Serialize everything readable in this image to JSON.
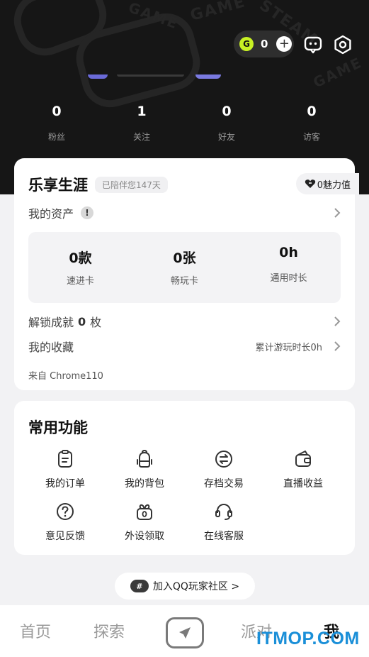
{
  "header": {
    "deco_words": [
      "GAME",
      "GAME",
      "STEAM",
      "GAME"
    ],
    "coins": {
      "icon": "G",
      "value": "0",
      "add_icon": "plus-icon"
    },
    "stats": [
      {
        "value": "0",
        "label": "粉丝"
      },
      {
        "value": "1",
        "label": "关注"
      },
      {
        "value": "0",
        "label": "好友"
      },
      {
        "value": "0",
        "label": "访客"
      }
    ]
  },
  "profile_card": {
    "title": "乐享生涯",
    "days_badge": "已陪伴您147天",
    "charm": "0魅力值",
    "assets_label": "我的资产",
    "assets_info_icon": "!",
    "assets": [
      {
        "value": "0款",
        "label": "速进卡"
      },
      {
        "value": "0张",
        "label": "畅玩卡"
      },
      {
        "value": "0h",
        "label": "通用时长"
      }
    ],
    "achievements_prefix": "解锁成就",
    "achievements_count": "0",
    "achievements_suffix": "枚",
    "favorites_label": "我的收藏",
    "play_time": "累计游玩时长0h",
    "source": "来自 Chrome110"
  },
  "functions_card": {
    "title": "常用功能",
    "items": [
      {
        "label": "我的订单",
        "icon": "clipboard-icon"
      },
      {
        "label": "我的背包",
        "icon": "backpack-icon"
      },
      {
        "label": "存档交易",
        "icon": "exchange-icon"
      },
      {
        "label": "直播收益",
        "icon": "wallet-icon"
      },
      {
        "label": "意见反馈",
        "icon": "question-icon"
      },
      {
        "label": "外设领取",
        "icon": "gift-icon"
      },
      {
        "label": "在线客服",
        "icon": "headset-icon"
      }
    ]
  },
  "community": {
    "icon_text": "#",
    "label": "加入QQ玩家社区 >"
  },
  "nav": {
    "items": [
      "首页",
      "探索",
      "派对",
      "我"
    ],
    "active": "我"
  },
  "watermark": "ITMOP.COM",
  "colors": {
    "header_bg": "#161616",
    "coin": "#c7f024",
    "page_bg": "#f2f2f4",
    "watermark": "#1a8fd8"
  }
}
